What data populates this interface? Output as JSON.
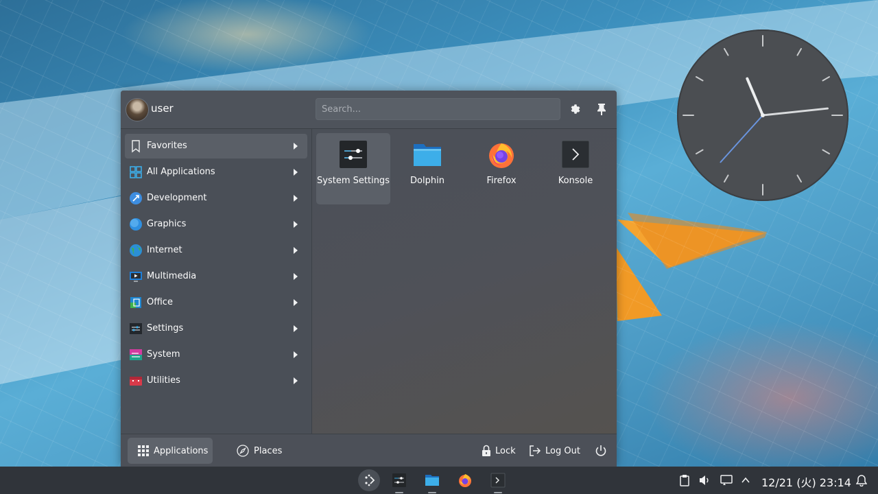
{
  "user": {
    "name": "user"
  },
  "search": {
    "placeholder": "Search..."
  },
  "header_buttons": [
    "configure-icon",
    "pin-icon"
  ],
  "categories": [
    {
      "label": "Favorites",
      "icon": "bookmark-icon",
      "active": true
    },
    {
      "label": "All Applications",
      "icon": "grid-icon"
    },
    {
      "label": "Development",
      "icon": "development-icon"
    },
    {
      "label": "Graphics",
      "icon": "graphics-icon"
    },
    {
      "label": "Internet",
      "icon": "globe-icon"
    },
    {
      "label": "Multimedia",
      "icon": "multimedia-icon"
    },
    {
      "label": "Office",
      "icon": "office-icon"
    },
    {
      "label": "Settings",
      "icon": "settings-icon"
    },
    {
      "label": "System",
      "icon": "system-icon"
    },
    {
      "label": "Utilities",
      "icon": "utilities-icon"
    }
  ],
  "favorites": [
    {
      "label": "System Settings",
      "icon": "system-settings-icon",
      "active": true
    },
    {
      "label": "Dolphin",
      "icon": "folder-icon"
    },
    {
      "label": "Firefox",
      "icon": "firefox-icon"
    },
    {
      "label": "Konsole",
      "icon": "terminal-icon"
    }
  ],
  "footer": {
    "tabs": [
      {
        "label": "Applications",
        "active": true
      },
      {
        "label": "Places"
      }
    ],
    "lock": "Lock",
    "logout": "Log Out"
  },
  "taskbar": {
    "apps": [
      "system-settings-icon",
      "folder-icon",
      "firefox-icon",
      "terminal-icon"
    ],
    "datetime": "12/21 (火) 23:14"
  },
  "clock_widget": {
    "hour": 23,
    "minute": 14
  },
  "colors": {
    "accent": "#3daee9",
    "panel": "#4a4f57",
    "taskbar": "#30343a"
  }
}
